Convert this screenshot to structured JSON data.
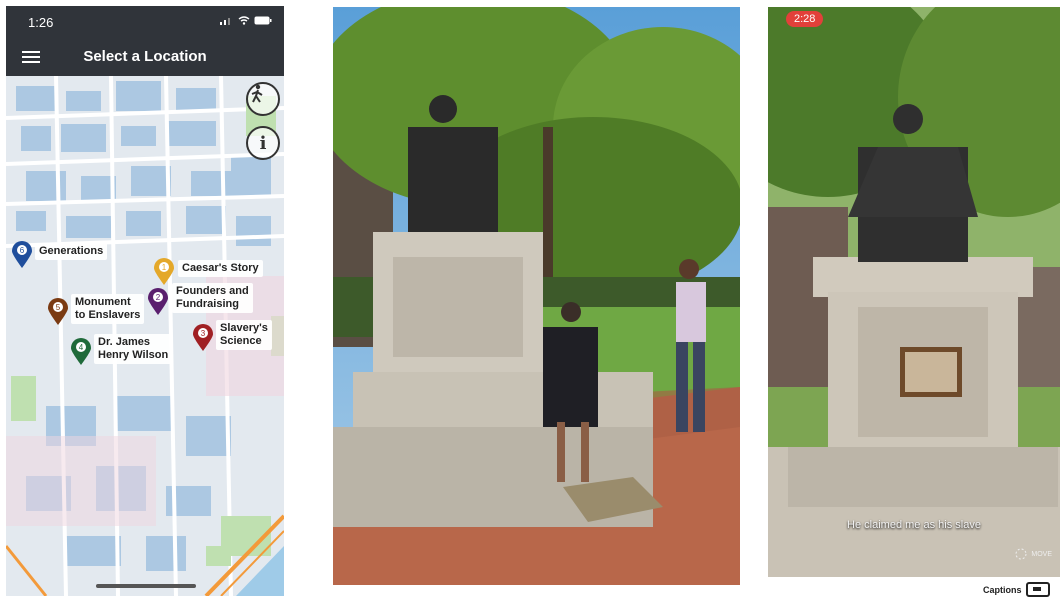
{
  "phone": {
    "status_time": "1:26",
    "title": "Select a Location"
  },
  "map": {
    "locations": [
      {
        "number": "6",
        "label": "Generations",
        "color": "#1f4e9c"
      },
      {
        "number": "1",
        "label": "Caesar's Story",
        "color": "#e4a82a"
      },
      {
        "number": "2",
        "label": "Founders and\nFundraising",
        "color": "#5a1f6e"
      },
      {
        "number": "5",
        "label": "Monument\nto Enslavers",
        "color": "#7a3a12"
      },
      {
        "number": "3",
        "label": "Slavery's\nScience",
        "color": "#a01f23"
      },
      {
        "number": "4",
        "label": "Dr. James\nHenry Wilson",
        "color": "#1f6a3a"
      }
    ],
    "buttons": {
      "walk_icon": "walking-person-icon",
      "info_icon": "info-icon"
    }
  },
  "ar": {
    "timer": "2:28",
    "caption": "He claimed me as his slave",
    "move_label": "MOVE",
    "captions_toggle": "Captions"
  }
}
